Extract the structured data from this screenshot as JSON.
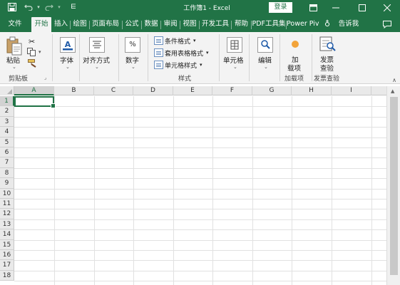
{
  "titlebar": {
    "title": "工作簿1  -  Excel",
    "login_label": "登录"
  },
  "tabs": [
    {
      "label": "文件"
    },
    {
      "label": "开始"
    },
    {
      "label": "插入"
    },
    {
      "label": "绘图"
    },
    {
      "label": "页面布局"
    },
    {
      "label": "公式"
    },
    {
      "label": "数据"
    },
    {
      "label": "审阅"
    },
    {
      "label": "视图"
    },
    {
      "label": "开发工具"
    },
    {
      "label": "帮助"
    },
    {
      "label": "PDF工具集"
    },
    {
      "label": "Power Pivot"
    },
    {
      "label": "告诉我"
    }
  ],
  "ribbon": {
    "clipboard": {
      "paste_label": "粘贴",
      "group_label": "剪贴板"
    },
    "font": {
      "label": "字体"
    },
    "alignment": {
      "label": "对齐方式"
    },
    "number": {
      "label": "数字",
      "icon_text": "%"
    },
    "styles": {
      "conditional_format": "条件格式",
      "table_format": "套用表格格式",
      "cell_styles": "单元格样式",
      "group_label": "样式"
    },
    "cells": {
      "label": "单元格"
    },
    "editing": {
      "label": "编辑"
    },
    "addins": {
      "line1": "加",
      "line2": "载项",
      "group_label": "加载项"
    },
    "invoice": {
      "line1": "发票",
      "line2": "查验",
      "group_label": "发票查验"
    }
  },
  "sheet": {
    "columns": [
      "A",
      "B",
      "C",
      "D",
      "E",
      "F",
      "G",
      "H",
      "I"
    ],
    "rows": [
      "1",
      "2",
      "3",
      "4",
      "5",
      "6",
      "7",
      "8",
      "9",
      "10",
      "11",
      "12",
      "13",
      "14",
      "15",
      "16",
      "17",
      "18"
    ],
    "selected_cell": "A1"
  },
  "colors": {
    "brand": "#217346",
    "ribbon_bg": "#f3f3f3"
  }
}
